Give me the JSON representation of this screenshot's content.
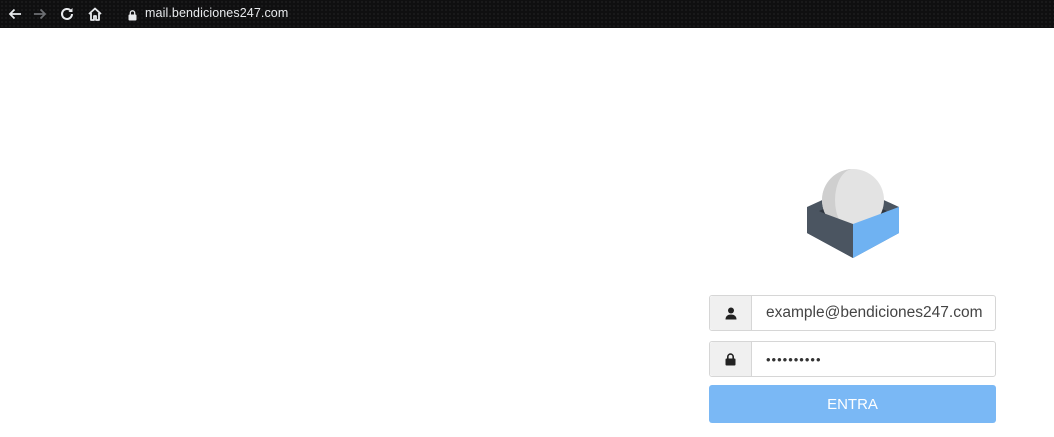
{
  "browser": {
    "url": "mail.bendiciones247.com",
    "icons": [
      "back-icon",
      "forward-icon",
      "reload-icon",
      "home-icon",
      "lock-icon"
    ]
  },
  "login": {
    "username_value": "example@bendiciones247.com",
    "password_mask": "••••••••••",
    "submit_label": "ENTRA",
    "icons": [
      "user-icon",
      "lock-icon"
    ]
  },
  "colors": {
    "accent": "#7ab8f5",
    "logo_dark": "#4b5561",
    "logo_blue": "#6fb2f2",
    "logo_gray": "#d9d9d9"
  }
}
